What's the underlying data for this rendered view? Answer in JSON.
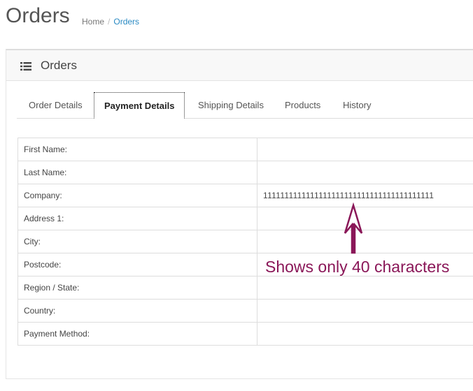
{
  "header": {
    "title": "Orders",
    "breadcrumb": {
      "home": "Home",
      "separator": "/",
      "current": "Orders"
    }
  },
  "panel": {
    "icon": "list-icon",
    "title": "Orders"
  },
  "tabs": [
    {
      "label": "Order Details",
      "active": false
    },
    {
      "label": "Payment Details",
      "active": true
    },
    {
      "label": "Shipping Details",
      "active": false
    },
    {
      "label": "Products",
      "active": false
    },
    {
      "label": "History",
      "active": false
    }
  ],
  "payment": {
    "rows": [
      {
        "label": "First Name:",
        "value": ""
      },
      {
        "label": "Last Name:",
        "value": ""
      },
      {
        "label": "Company:",
        "value": "1111111111111111111111111111111111111111"
      },
      {
        "label": "Address 1:",
        "value": ""
      },
      {
        "label": "City:",
        "value": ""
      },
      {
        "label": "Postcode:",
        "value": ""
      },
      {
        "label": "Region / State:",
        "value": ""
      },
      {
        "label": "Country:",
        "value": ""
      },
      {
        "label": "Payment Method:",
        "value": ""
      }
    ]
  },
  "annotation": {
    "text": "Shows only 40 characters",
    "color": "#8a1758"
  },
  "colors": {
    "link": "#2a8ac3",
    "annotation": "#8a1758"
  }
}
